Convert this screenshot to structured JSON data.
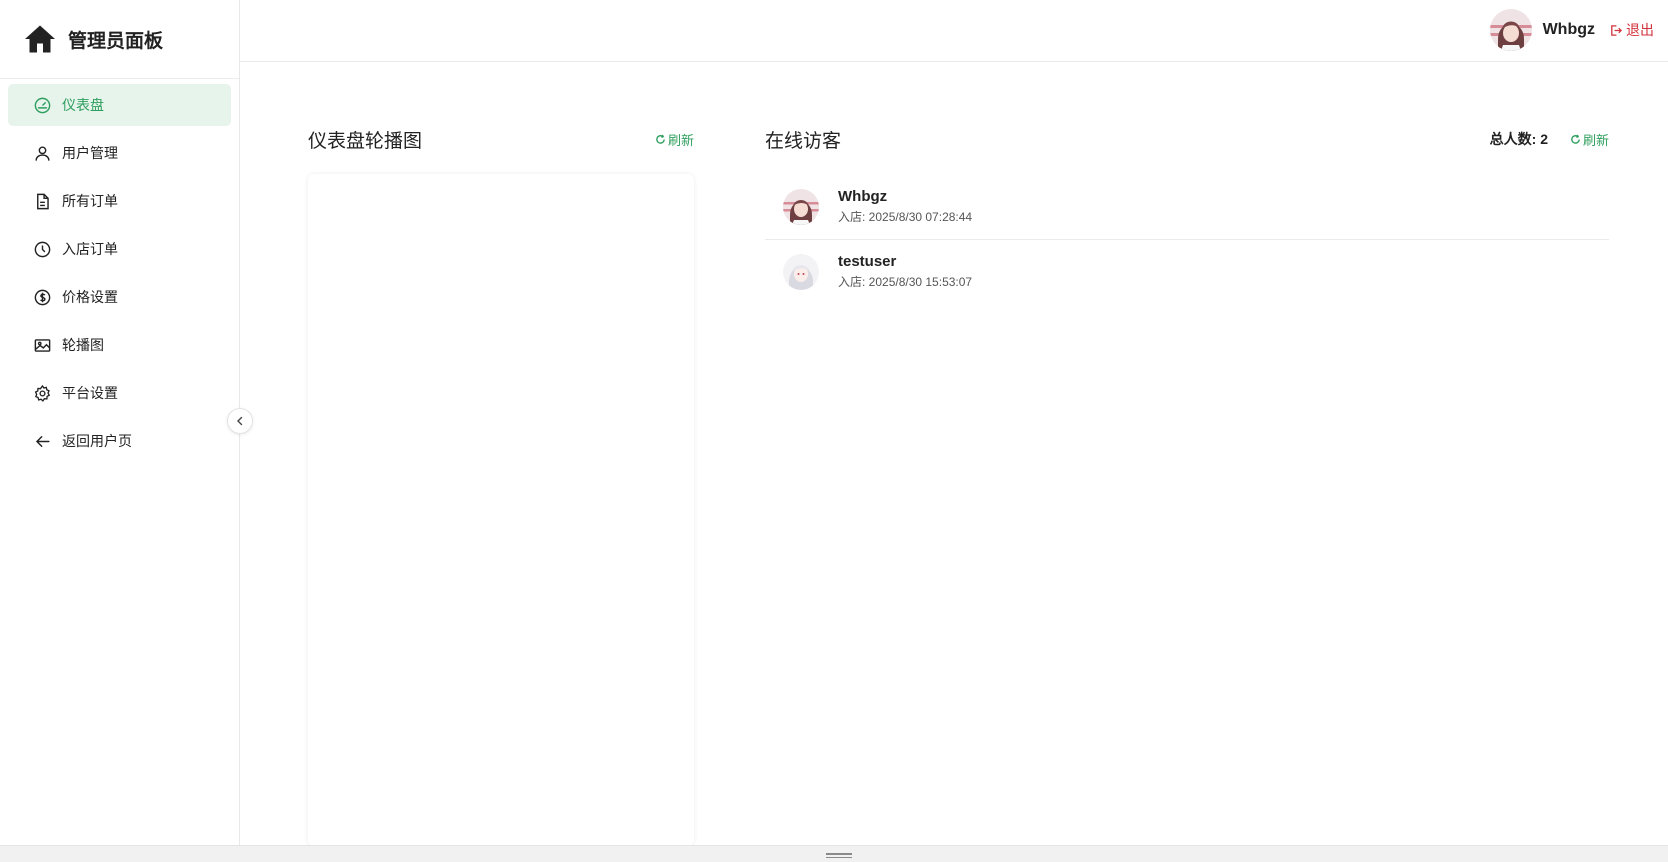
{
  "sidebar": {
    "title": "管理员面板",
    "items": [
      {
        "label": "仪表盘",
        "icon": "dashboard-icon",
        "active": true
      },
      {
        "label": "用户管理",
        "icon": "user-icon"
      },
      {
        "label": "所有订单",
        "icon": "document-icon"
      },
      {
        "label": "入店订单",
        "icon": "clock-icon"
      },
      {
        "label": "价格设置",
        "icon": "dollar-icon"
      },
      {
        "label": "轮播图",
        "icon": "image-icon"
      },
      {
        "label": "平台设置",
        "icon": "gear-icon"
      },
      {
        "label": "返回用户页",
        "icon": "arrow-left-icon"
      }
    ]
  },
  "header": {
    "username": "Whbgz",
    "logout_label": "退出"
  },
  "carousel_panel": {
    "title": "仪表盘轮播图",
    "refresh_label": "刷新"
  },
  "visitors_panel": {
    "title": "在线访客",
    "total_label": "总人数: 2",
    "refresh_label": "刷新",
    "visitors": [
      {
        "name": "Whbgz",
        "time": "入店: 2025/8/30 07:28:44"
      },
      {
        "name": "testuser",
        "time": "入店: 2025/8/30 15:53:07"
      }
    ]
  },
  "colors": {
    "accent": "#2e9e5e",
    "active_bg": "#e6f4ec",
    "danger": "#d2323c"
  }
}
